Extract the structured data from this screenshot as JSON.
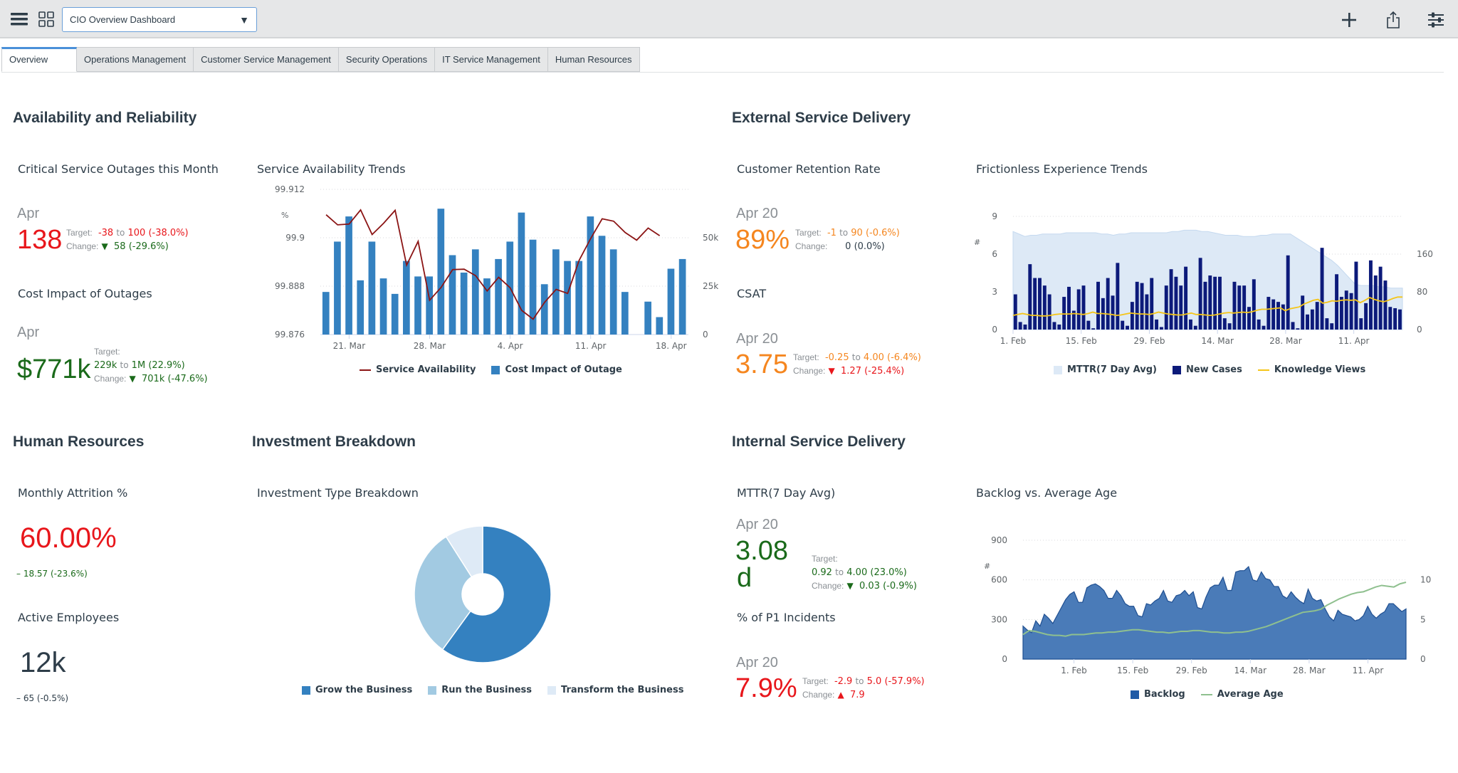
{
  "topbar": {
    "dashboard_select": "CIO Overview Dashboard",
    "icons": [
      "menu-icon",
      "apps-grid-icon",
      "plus-icon",
      "share-icon",
      "filter-sliders-icon"
    ]
  },
  "tabs": [
    {
      "label": "Overview",
      "active": true
    },
    {
      "label": "Operations Management",
      "active": false
    },
    {
      "label": "Customer Service Management",
      "active": false
    },
    {
      "label": "Security Operations",
      "active": false
    },
    {
      "label": "IT Service Management",
      "active": false
    },
    {
      "label": "Human Resources",
      "active": false
    }
  ],
  "sections": {
    "availability": "Availability and Reliability",
    "external": "External Service Delivery",
    "hr": "Human Resources",
    "investment": "Investment Breakdown",
    "internal": "Internal Service Delivery"
  },
  "kpis": {
    "outages": {
      "title": "Critical Service Outages this Month",
      "date": "Apr",
      "value": "138",
      "target_label": "Target:",
      "target_delta": "-38",
      "to": "to",
      "target_value": "100",
      "target_pct": "(-38.0%)",
      "change_label": "Change:",
      "change_arrow": "▼",
      "change_value": "58 (-29.6%)"
    },
    "cost": {
      "title": "Cost Impact of Outages",
      "date": "Apr",
      "value": "$771k",
      "target_label": "Target:",
      "target_delta": "229k",
      "to": "to",
      "target_value": "1M",
      "target_pct": "(22.9%)",
      "change_label": "Change:",
      "change_arrow": "▼",
      "change_value": "701k (-47.6%)"
    },
    "retention": {
      "title": "Customer Retention Rate",
      "date": "Apr 20",
      "value": "89%",
      "target_label": "Target:",
      "target_delta": "-1",
      "to": "to",
      "target_value": "90",
      "target_pct": "(-0.6%)",
      "change_label": "Change:",
      "change_value": "0 (0.0%)"
    },
    "csat": {
      "title": "CSAT",
      "date": "Apr 20",
      "value": "3.75",
      "target_label": "Target:",
      "target_delta": "-0.25",
      "to": "to",
      "target_value": "4.00",
      "target_pct": "(-6.4%)",
      "change_label": "Change:",
      "change_arrow": "▼",
      "change_value": "1.27 (-25.4%)"
    },
    "attrition": {
      "title": "Monthly Attrition %",
      "value": "60.00%",
      "change": "– 18.57 (-23.6%)"
    },
    "employees": {
      "title": "Active Employees",
      "value": "12k",
      "change": "– 65 (-0.5%)"
    },
    "mttr": {
      "title": "MTTR(7 Day Avg)",
      "date": "Apr 20",
      "value_line1": "3.08",
      "value_line2": "d",
      "target_label": "Target:",
      "target_delta": "0.92",
      "to": "to",
      "target_value": "4.00",
      "target_pct": "(23.0%)",
      "change_label": "Change:",
      "change_arrow": "▼",
      "change_value": "0.03 (-0.9%)"
    },
    "p1": {
      "title": "% of P1 Incidents",
      "date": "Apr 20",
      "value": "7.9%",
      "target_label": "Target:",
      "target_delta": "-2.9",
      "to": "to",
      "target_value": "5.0",
      "target_pct": "(-57.9%)",
      "change_label": "Change:",
      "change_arrow": "▲",
      "change_value": "7.9"
    }
  },
  "colors": {
    "red": "#e8161b",
    "green": "#1a6a1a",
    "orange": "#f5861f",
    "bar_blue": "#3481c0",
    "line_red": "#8b1414",
    "navy": "#0c1a7a",
    "light_area": "#dde9f6",
    "yellow": "#f5c518",
    "backlog": "#4a7bb8",
    "avg_age": "#8fc08f",
    "pie": [
      "#3481c0",
      "#a2cae2",
      "#deeaf6"
    ]
  },
  "chart_data": [
    {
      "id": "service_availability",
      "type": "bar",
      "title": "Service Availability Trends",
      "ylabel_left": "%",
      "y_left_ticks": [
        "99.912",
        "99.9",
        "99.888",
        "99.876"
      ],
      "y_left_range": [
        99.876,
        99.912
      ],
      "y_right_ticks": [
        "50k",
        "25k",
        "0"
      ],
      "y_right_range": [
        0,
        75000
      ],
      "x_ticks": [
        "21. Mar",
        "28. Mar",
        "4. Apr",
        "11. Apr",
        "18. Apr"
      ],
      "x_tick_day_index": [
        2,
        9,
        16,
        23,
        30
      ],
      "legend": [
        "Service Availability",
        "Cost Impact of Outage"
      ],
      "series": [
        {
          "name": "Cost Impact of Outage",
          "type": "bar",
          "values": [
            22000,
            48000,
            61000,
            28000,
            48000,
            29000,
            21000,
            38000,
            30000,
            30000,
            65000,
            41000,
            32000,
            44000,
            29000,
            39000,
            48000,
            63000,
            49000,
            26000,
            44000,
            38000,
            38000,
            61000,
            51000,
            44000,
            22000,
            0,
            17000,
            9000,
            34000,
            39000
          ]
        },
        {
          "name": "Service Availability",
          "type": "line",
          "values": [
            99.9057,
            99.9032,
            99.9034,
            99.9069,
            99.9008,
            99.9036,
            99.9068,
            99.8932,
            99.8991,
            99.8845,
            99.8877,
            99.8921,
            99.8922,
            99.8906,
            99.8868,
            99.8902,
            99.8876,
            99.882,
            99.8798,
            99.884,
            99.8872,
            99.8862,
            99.8944,
            99.8998,
            99.9047,
            99.9041,
            99.9013,
            99.8994,
            99.9024,
            99.9005
          ]
        }
      ]
    },
    {
      "id": "frictionless",
      "type": "bar",
      "title": "Frictionless Experience Trends",
      "ylabel_left": "#",
      "y_left_ticks": [
        "9",
        "6",
        "3",
        "0"
      ],
      "y_left_range": [
        0,
        9
      ],
      "y_right_ticks": [
        "160",
        "80",
        "0"
      ],
      "y_right_range": [
        0,
        240
      ],
      "x_ticks": [
        "1. Feb",
        "15. Feb",
        "29. Feb",
        "14. Mar",
        "28. Mar",
        "11. Apr"
      ],
      "legend": [
        "MTTR(7 Day Avg)",
        "New Cases",
        "Knowledge Views"
      ],
      "series": [
        {
          "name": "MTTR(7 Day Avg)",
          "type": "area",
          "values": [
            7.8,
            7.6,
            7.4,
            7.5,
            7.5,
            7.6,
            7.6,
            7.6,
            7.6,
            7.7,
            7.7,
            7.7,
            7.7,
            7.7,
            7.7,
            7.6,
            7.6,
            7.5,
            7.6,
            7.6,
            7.7,
            7.7,
            7.7,
            7.7,
            7.7,
            7.7,
            7.7,
            7.8,
            7.8,
            7.9,
            7.9,
            7.9,
            7.8,
            7.8,
            7.7,
            7.6,
            7.5,
            7.5,
            7.5,
            7.4,
            7.4,
            7.4,
            7.5,
            7.5,
            7.6,
            7.6,
            7.6,
            7.6,
            7.3,
            7.0,
            6.7,
            6.4,
            6.1,
            5.8,
            5.5,
            5.1,
            4.6,
            4.1,
            3.6,
            3.5,
            3.5,
            3.5,
            3.4,
            3.4,
            3.3,
            3.3,
            3.3
          ]
        },
        {
          "name": "New Cases",
          "type": "bar",
          "values": [
            2.8,
            0.6,
            0.4,
            5.2,
            4.1,
            4.1,
            3.5,
            2.8,
            0.6,
            0.4,
            2.6,
            3.4,
            1.5,
            3.2,
            3.5,
            0.7,
            0.1,
            3.8,
            2.5,
            4.1,
            2.7,
            5.3,
            0.7,
            0.3,
            2.2,
            3.8,
            3.7,
            2.8,
            4.1,
            0.8,
            0.2,
            3.5,
            4.8,
            4.2,
            3.5,
            5.0,
            0.8,
            0.3,
            5.7,
            3.8,
            4.3,
            4.2,
            4.2,
            0.9,
            0.5,
            3.8,
            3.5,
            3.5,
            1.8,
            4.0,
            0.8,
            0.3,
            2.6,
            2.4,
            2.2,
            2.0,
            5.9,
            0.6,
            0.1,
            2.7,
            1.2,
            1.6,
            2.2,
            6.5,
            0.9,
            0.5,
            4.4,
            2.6,
            3.1,
            2.9,
            5.4,
            0.9,
            2.1,
            5.5,
            4.3,
            5.0,
            3.9,
            1.8,
            1.7,
            1.6
          ]
        },
        {
          "name": "Knowledge Views",
          "type": "line",
          "values": [
            30,
            32,
            34,
            32,
            30,
            30,
            29,
            29,
            30,
            32,
            33,
            33,
            33,
            34,
            33,
            32,
            34,
            37,
            34,
            34,
            33,
            32,
            30,
            31,
            33,
            35,
            34,
            33,
            33,
            32,
            34,
            37,
            35,
            33,
            32,
            31,
            31,
            33,
            35,
            32,
            32,
            31,
            30,
            31,
            33,
            35,
            36,
            35,
            36,
            37,
            36,
            38,
            41,
            43,
            43,
            44,
            45,
            46,
            40,
            44,
            46,
            48,
            54,
            58,
            62,
            64,
            56,
            58,
            61,
            60,
            62,
            63,
            62,
            63,
            57,
            62,
            68,
            64,
            61,
            59,
            62,
            66,
            69,
            69
          ]
        }
      ]
    },
    {
      "id": "investment",
      "type": "pie",
      "title": "Investment Type Breakdown",
      "donut": true,
      "legend": [
        "Grow the Business",
        "Run the Business",
        "Transform the Business"
      ],
      "series": [
        {
          "name": "Grow the Business",
          "value": 60
        },
        {
          "name": "Run the Business",
          "value": 31
        },
        {
          "name": "Transform the Business",
          "value": 9
        }
      ]
    },
    {
      "id": "backlog",
      "type": "area",
      "title": "Backlog vs. Average Age",
      "ylabel_left": "#",
      "y_left_ticks": [
        "900",
        "600",
        "300",
        "0"
      ],
      "y_left_range": [
        0,
        900
      ],
      "y_right_ticks": [
        "10",
        "5",
        "0"
      ],
      "y_right_range": [
        0,
        15
      ],
      "x_ticks": [
        "1. Feb",
        "15. Feb",
        "29. Feb",
        "14. Mar",
        "28. Mar",
        "11. Apr"
      ],
      "legend": [
        "Backlog",
        "Average Age"
      ],
      "series": [
        {
          "name": "Backlog",
          "type": "area",
          "values": [
            250,
            220,
            200,
            290,
            250,
            340,
            310,
            270,
            330,
            390,
            450,
            490,
            510,
            430,
            430,
            540,
            560,
            570,
            550,
            520,
            460,
            460,
            520,
            480,
            420,
            400,
            400,
            330,
            320,
            420,
            410,
            440,
            460,
            520,
            440,
            430,
            480,
            490,
            520,
            480,
            510,
            390,
            380,
            470,
            540,
            560,
            560,
            620,
            520,
            520,
            660,
            670,
            670,
            700,
            600,
            590,
            660,
            610,
            600,
            550,
            550,
            480,
            460,
            510,
            470,
            440,
            420,
            530,
            460,
            440,
            450,
            380,
            320,
            290,
            370,
            340,
            330,
            320,
            290,
            300,
            330,
            400,
            340,
            310,
            340,
            360,
            420,
            420,
            390,
            360,
            380
          ]
        },
        {
          "name": "Average Age",
          "type": "line",
          "values": [
            3.1,
            3.6,
            3.5,
            3.3,
            3.1,
            3.0,
            3.0,
            2.9,
            3.1,
            3.1,
            3.1,
            3.2,
            3.3,
            3.3,
            3.4,
            3.4,
            3.5,
            3.6,
            3.7,
            3.7,
            3.6,
            3.5,
            3.4,
            3.4,
            3.3,
            3.4,
            3.5,
            3.5,
            3.6,
            3.6,
            3.5,
            3.4,
            3.4,
            3.3,
            3.3,
            3.4,
            3.4,
            3.5,
            3.7,
            3.9,
            4.1,
            4.4,
            4.7,
            5.0,
            5.3,
            5.6,
            5.9,
            6.0,
            6.1,
            6.3,
            6.8,
            7.2,
            7.6,
            7.9,
            8.2,
            8.4,
            8.5,
            8.8,
            9.1,
            9.3,
            9.2,
            9.1,
            9.5,
            9.7
          ]
        }
      ]
    }
  ]
}
